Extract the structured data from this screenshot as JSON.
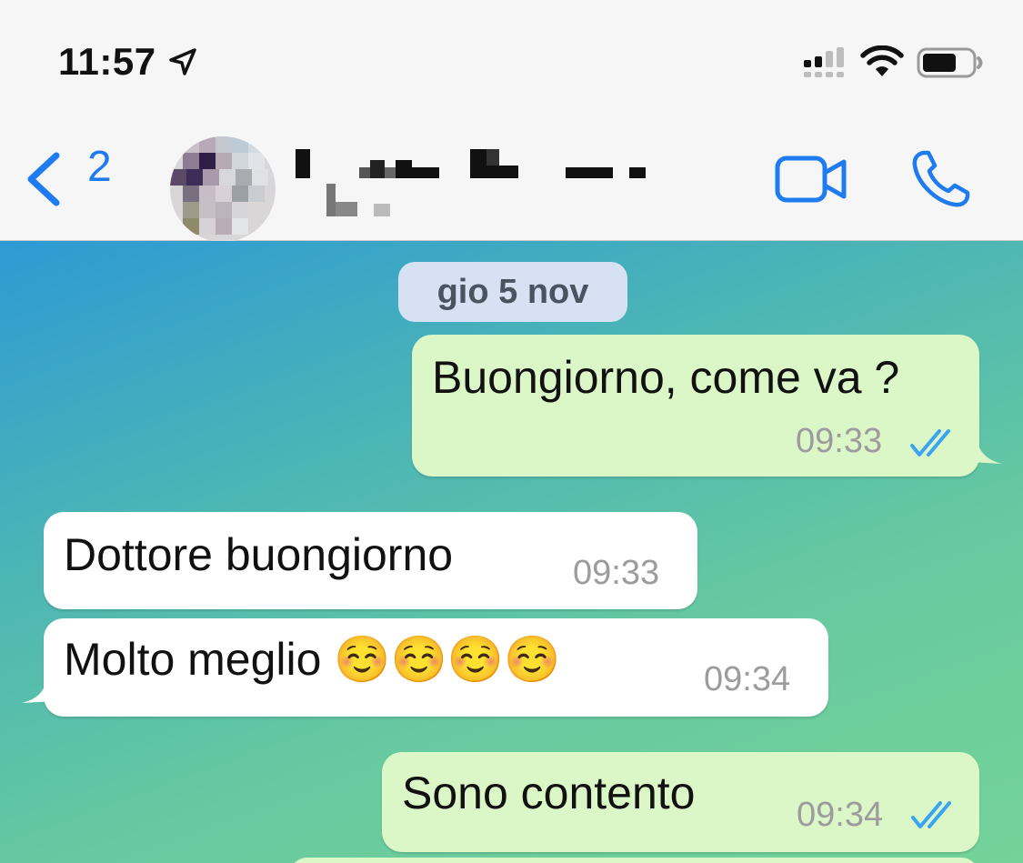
{
  "status_bar": {
    "time": "11:57",
    "location_icon": "location-arrow-icon",
    "signal_icon": "cellular-signal-icon",
    "wifi_icon": "wifi-icon",
    "battery_icon": "battery-icon"
  },
  "header": {
    "back_icon": "chevron-left-icon",
    "back_count": "2",
    "contact_name_pixelated": true,
    "video_call_icon": "video-camera-icon",
    "voice_call_icon": "phone-icon",
    "accent_color": "#1f7cf0"
  },
  "chat": {
    "date_separator": "gio 5 nov",
    "messages": [
      {
        "direction": "outgoing",
        "text": "Buongiorno, come va ?",
        "time": "09:33",
        "status_icon": "double-check-icon"
      },
      {
        "direction": "incoming",
        "text": "Dottore buongiorno",
        "time": "09:33"
      },
      {
        "direction": "incoming",
        "text": "Molto meglio ☺️☺️☺️☺️",
        "time": "09:34"
      },
      {
        "direction": "outgoing",
        "text": "Sono contento",
        "time": "09:34",
        "status_icon": "double-check-icon"
      }
    ],
    "outgoing_bubble_color": "#dcf7c7",
    "incoming_bubble_color": "#ffffff",
    "read_tick_color": "#3aa3f2"
  }
}
